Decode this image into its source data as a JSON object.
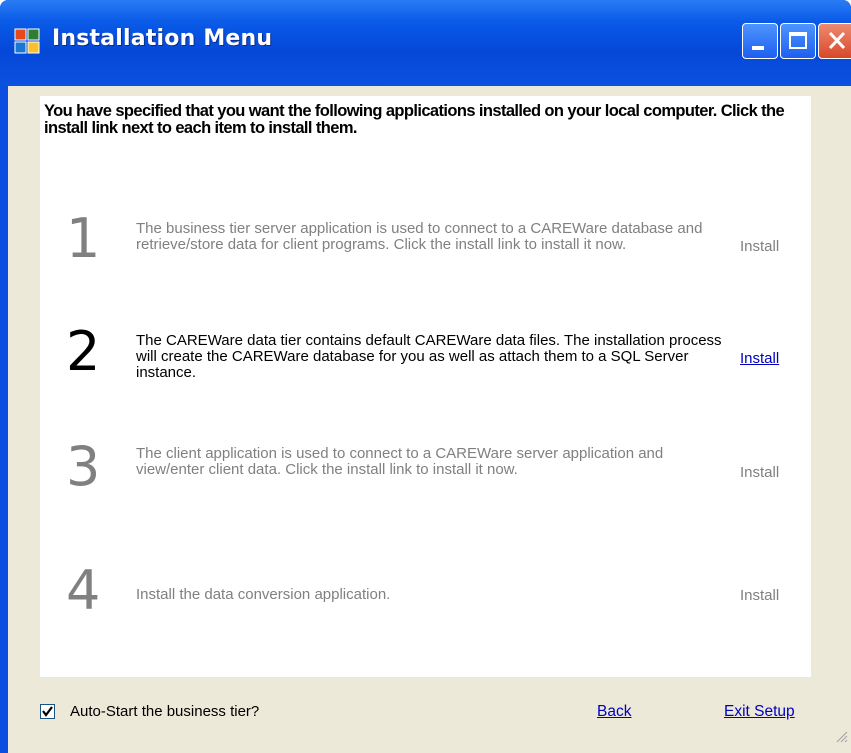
{
  "window": {
    "title": "Installation Menu",
    "title_color": "#ffffff",
    "titlebar_color": "#0a52e0"
  },
  "header": {
    "text": "You have specified that you want the following applications installed on your local computer. Click the install link next to each item to install them."
  },
  "items": [
    {
      "number": "1",
      "description": "The business tier server application is used to connect to a CAREWare database and retrieve/store data for client programs. Click the install link to install it now.",
      "link_label": "Install",
      "enabled": false
    },
    {
      "number": "2",
      "description": "The CAREWare data tier contains default CAREWare data files. The installation process will create the CAREWare database for you as well as attach them to a SQL Server instance.",
      "link_label": "Install",
      "enabled": true
    },
    {
      "number": "3",
      "description": "The client application is used to connect to a CAREWare server application and view/enter client data. Click the install link to install it now.",
      "link_label": "Install",
      "enabled": false
    },
    {
      "number": "4",
      "description": "Install the data conversion application.",
      "link_label": "Install",
      "enabled": false
    }
  ],
  "footer": {
    "autostart_label": "Auto-Start the business tier?",
    "autostart_checked": true,
    "back_label": "Back",
    "exit_label": "Exit Setup"
  },
  "colors": {
    "link": "#0000c0",
    "disabled_text": "#808080",
    "dialog_background": "#ece9d8"
  },
  "icons": {
    "window_icon": "app-window-icon",
    "minimize": "minimize-icon",
    "maximize": "maximize-icon",
    "close": "close-icon"
  }
}
